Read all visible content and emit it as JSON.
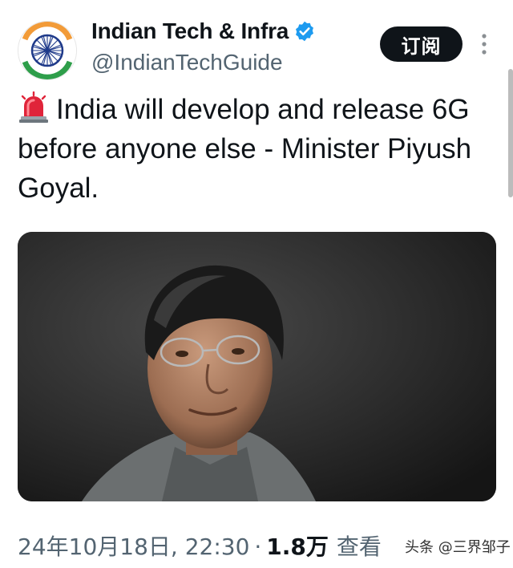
{
  "account": {
    "display_name": "Indian Tech & Infra",
    "handle": "@IndianTechGuide",
    "avatar_icon": "ashoka-chakra-flag-avatar",
    "verified_icon": "verified-badge-icon",
    "verified_color": "#1d9bf0"
  },
  "actions": {
    "follow_label": "订阅",
    "more_icon": "more-vertical-icon"
  },
  "tweet": {
    "emoji_icon": "police-siren-icon",
    "text": "India will develop and release 6G before anyone else - Minister Piyush Goyal."
  },
  "media": {
    "type": "photo"
  },
  "meta": {
    "timestamp": "24年10月18日, 22:30",
    "separator": "·",
    "views_count": "1.8万",
    "views_label": "查看"
  },
  "watermark": {
    "text": "头条 @三界邹子"
  },
  "colors": {
    "text_primary": "#0f1419",
    "text_secondary": "#536471",
    "button_bg": "#0f1419",
    "button_text": "#ffffff"
  }
}
